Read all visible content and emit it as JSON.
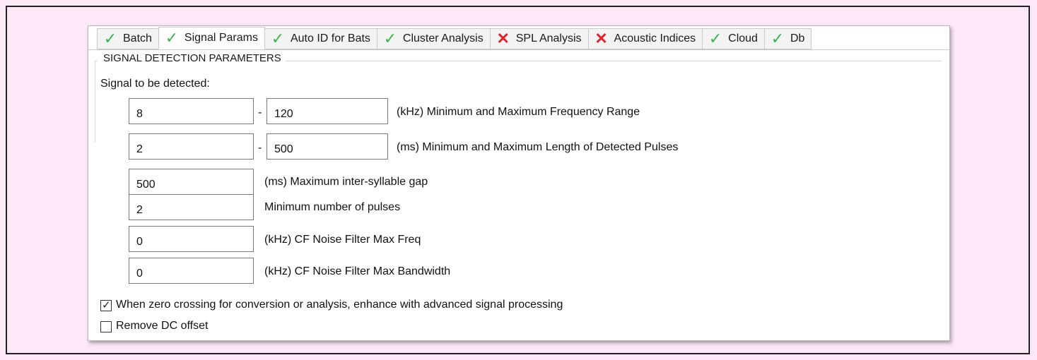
{
  "tabs": [
    {
      "label": "Batch",
      "status": "check"
    },
    {
      "label": "Signal Params",
      "status": "check",
      "active": true
    },
    {
      "label": "Auto ID for Bats",
      "status": "check"
    },
    {
      "label": "Cluster Analysis",
      "status": "check"
    },
    {
      "label": "SPL Analysis",
      "status": "cross"
    },
    {
      "label": "Acoustic Indices",
      "status": "cross"
    },
    {
      "label": "Cloud",
      "status": "check"
    },
    {
      "label": "Db",
      "status": "check"
    }
  ],
  "group_title": "SIGNAL DETECTION PARAMETERS",
  "signal_label": "Signal to be detected:",
  "frequency": {
    "min": "8",
    "max": "120",
    "label": "(kHz) Minimum and Maximum Frequency Range"
  },
  "pulse_length": {
    "min": "2",
    "max": "500",
    "label": "(ms) Minimum and Maximum Length of Detected Pulses"
  },
  "dash": "-",
  "gap": {
    "value": "500",
    "label": "(ms) Maximum inter-syllable gap"
  },
  "min_pulses": {
    "value": "2",
    "label": "Minimum number of pulses"
  },
  "cf_max_freq": {
    "value": "0",
    "label": "(kHz) CF Noise Filter Max Freq"
  },
  "cf_max_bw": {
    "value": "0",
    "label": "(kHz) CF Noise Filter Max Bandwidth"
  },
  "zero_crossing": {
    "label": "When zero crossing for conversion or analysis, enhance with advanced signal processing",
    "checked": true
  },
  "dc_offset": {
    "label": "Remove DC offset",
    "checked": false
  },
  "colors": {
    "check": "#3bb54a",
    "cross": "#e4202a",
    "background": "#fce8f7"
  }
}
